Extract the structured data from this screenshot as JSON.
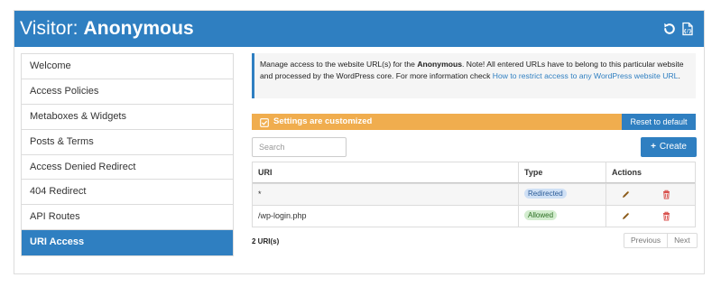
{
  "header": {
    "title_prefix": "Visitor: ",
    "title_name": "Anonymous",
    "bg_color": "#2f7fc1",
    "icons": [
      "reset-icon",
      "export-icon"
    ]
  },
  "sidebar": {
    "items": [
      {
        "label": "Welcome"
      },
      {
        "label": "Access Policies"
      },
      {
        "label": "Metaboxes & Widgets"
      },
      {
        "label": "Posts & Terms"
      },
      {
        "label": "Access Denied Redirect"
      },
      {
        "label": "404 Redirect"
      },
      {
        "label": "API Routes"
      },
      {
        "label": "URI Access",
        "active": true
      }
    ]
  },
  "notice": {
    "text_before": "Manage access to the website URL(s) for the ",
    "role": "Anonymous",
    "text_after": ". Note! All entered URLs have to belong to this particular website and processed by the WordPress core. For more information check ",
    "link_text": "How to restrict access to any WordPress website URL",
    "text_end": "."
  },
  "banner": {
    "message": "Settings are customized",
    "reset_label": "Reset to default",
    "color": "#f0ad4e"
  },
  "toolbar": {
    "search_placeholder": "Search",
    "create_label": "Create"
  },
  "table": {
    "columns": [
      "URI",
      "Type",
      "Actions"
    ],
    "rows": [
      {
        "uri": "*",
        "type": "Redirected",
        "type_bg": "#cfe0f5",
        "type_fg": "#2a5a96"
      },
      {
        "uri": "/wp-login.php",
        "type": "Allowed",
        "type_bg": "#d3edcf",
        "type_fg": "#2b6e22"
      }
    ]
  },
  "footer": {
    "count": "2 URI(s)",
    "prev_label": "Previous",
    "next_label": "Next"
  }
}
